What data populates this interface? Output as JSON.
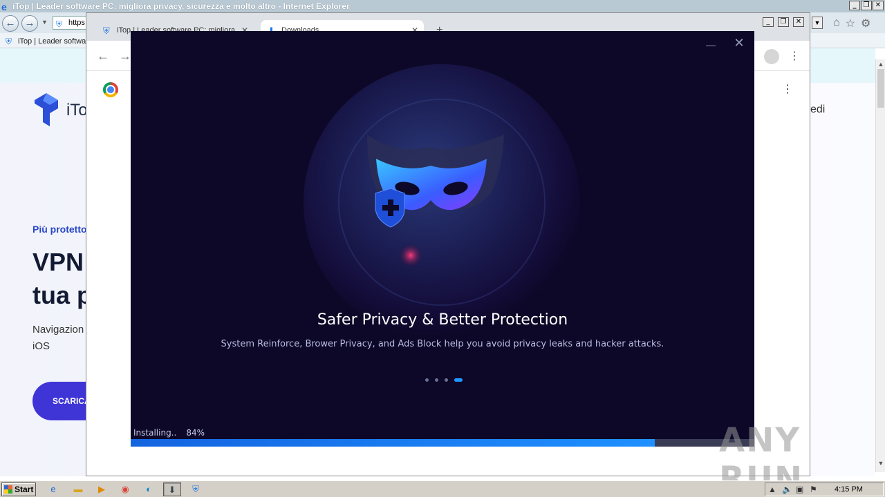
{
  "ie": {
    "title": "iTop | Leader software PC: migliora privacy, sicurezza e molto altro - Internet Explorer",
    "address": "https",
    "tab_label": "iTop | Leader softwa",
    "page": {
      "logo_text": "iTo",
      "tagline": "Più protetto",
      "headline": "VPN tua p",
      "description": "Navigazion Mac e iOS",
      "cta_label": "SCARICA",
      "right_text": "edi"
    }
  },
  "chrome": {
    "tabs": [
      {
        "label": "iTop | Leader software PC: migliora"
      },
      {
        "label": "Downloads"
      }
    ]
  },
  "installer": {
    "headline": "Safer Privacy & Better Protection",
    "subtitle": "System Reinforce, Brower Privacy, and Ads Block help you avoid privacy leaks and hacker attacks.",
    "status_label": "Installing..",
    "progress_text": "84%",
    "progress": 0.84,
    "slides_total": 4,
    "slide_active": 4,
    "colors": {
      "background": "#0d0828",
      "accent": "#2196ff"
    }
  },
  "watermark": "ANY RUN",
  "taskbar": {
    "start_label": "Start",
    "clock": "4:15 PM"
  }
}
